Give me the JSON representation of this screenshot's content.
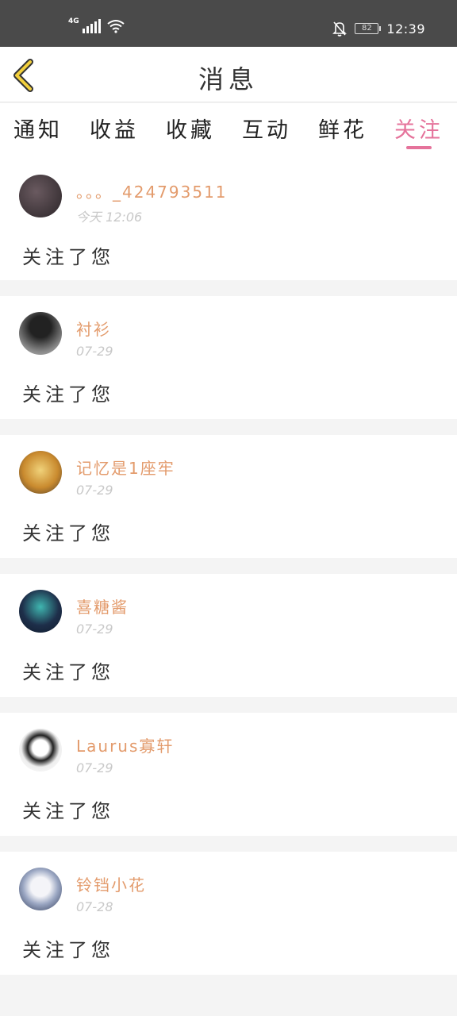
{
  "status_bar": {
    "network": "4G",
    "battery": "82",
    "time": "12:39"
  },
  "header": {
    "title": "消息"
  },
  "tabs": [
    {
      "label": "通知",
      "active": false
    },
    {
      "label": "收益",
      "active": false
    },
    {
      "label": "收藏",
      "active": false
    },
    {
      "label": "互动",
      "active": false
    },
    {
      "label": "鲜花",
      "active": false
    },
    {
      "label": "关注",
      "active": true
    }
  ],
  "items": [
    {
      "name": "。。。_424793511",
      "date": "今天  12:06",
      "message": "关注了您",
      "avatar_color": "#3a3338"
    },
    {
      "name": "衬衫",
      "date": "07-29",
      "message": "关注了您",
      "avatar_color": "#555555"
    },
    {
      "name": "记忆是1座牢",
      "date": "07-29",
      "message": "关注了您",
      "avatar_color": "#c99a3a"
    },
    {
      "name": "喜糖酱",
      "date": "07-29",
      "message": "关注了您",
      "avatar_color": "#2e4a6b"
    },
    {
      "name": "Laurus寡轩",
      "date": "07-29",
      "message": "关注了您",
      "avatar_color": "#e8e8e8"
    },
    {
      "name": "铃铛小花",
      "date": "07-28",
      "message": "关注了您",
      "avatar_color": "#5a6f8f"
    }
  ],
  "colors": {
    "accent": "#e5739b",
    "name": "#e39b6c",
    "back_arrow": "#f2cf3c"
  }
}
